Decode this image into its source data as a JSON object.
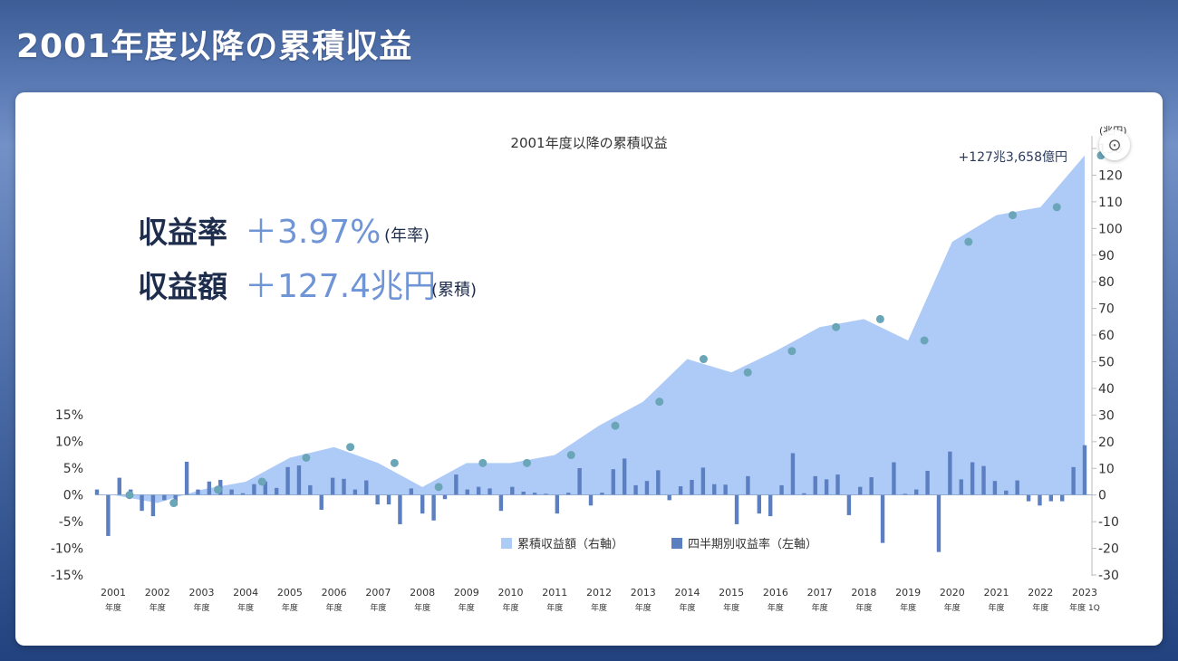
{
  "page_title": "2001年度以降の累積収益",
  "chart_data": {
    "type": "bar+area",
    "title": "2001年度以降の累積収益",
    "right_axis_unit": "(兆円)",
    "left_axis": {
      "ylim": [
        -15,
        15
      ],
      "ticks": [
        "15%",
        "10%",
        "5%",
        "0%",
        "-5%",
        "-10%",
        "-15%"
      ],
      "tick_values": [
        15,
        10,
        5,
        0,
        -5,
        -10,
        -15
      ]
    },
    "right_axis": {
      "ylim": [
        -30,
        130
      ],
      "ticks": [
        130,
        120,
        110,
        100,
        90,
        80,
        70,
        60,
        50,
        40,
        30,
        20,
        10,
        0,
        -10,
        -20,
        -30
      ]
    },
    "x_labels": [
      {
        "year": "2001",
        "sub": "年度"
      },
      {
        "year": "2002",
        "sub": "年度"
      },
      {
        "year": "2003",
        "sub": "年度"
      },
      {
        "year": "2004",
        "sub": "年度"
      },
      {
        "year": "2005",
        "sub": "年度"
      },
      {
        "year": "2006",
        "sub": "年度"
      },
      {
        "year": "2007",
        "sub": "年度"
      },
      {
        "year": "2008",
        "sub": "年度"
      },
      {
        "year": "2009",
        "sub": "年度"
      },
      {
        "year": "2010",
        "sub": "年度"
      },
      {
        "year": "2011",
        "sub": "年度"
      },
      {
        "year": "2012",
        "sub": "年度"
      },
      {
        "year": "2013",
        "sub": "年度"
      },
      {
        "year": "2014",
        "sub": "年度"
      },
      {
        "year": "2015",
        "sub": "年度"
      },
      {
        "year": "2016",
        "sub": "年度"
      },
      {
        "year": "2017",
        "sub": "年度"
      },
      {
        "year": "2018",
        "sub": "年度"
      },
      {
        "year": "2019",
        "sub": "年度"
      },
      {
        "year": "2020",
        "sub": "年度"
      },
      {
        "year": "2021",
        "sub": "年度"
      },
      {
        "year": "2022",
        "sub": "年度"
      },
      {
        "year": "2023",
        "sub": "年度 1Q"
      }
    ],
    "series": [
      {
        "name": "累積収益額（右軸）",
        "kind": "area",
        "color": "#aecbf7",
        "marker_color": "#6ba6b8",
        "values": [
          0,
          -3,
          2,
          5,
          14,
          18,
          12,
          3,
          12,
          12,
          15,
          26,
          35,
          51,
          46,
          54,
          63,
          66,
          58,
          95,
          105,
          108,
          127.4
        ]
      },
      {
        "name": "四半期別収益率（左軸）",
        "kind": "bar",
        "color": "#5b7fc0",
        "values": [
          1.0,
          -7.7,
          3.2,
          1.0,
          -3.0,
          -4.0,
          -1.0,
          -2.0,
          6.2,
          1.0,
          2.5,
          2.8,
          1.0,
          0.3,
          2.0,
          2.5,
          1.3,
          5.2,
          5.5,
          1.8,
          -2.8,
          3.2,
          3.0,
          1.0,
          2.7,
          -1.8,
          -1.8,
          -5.5,
          1.2,
          -3.5,
          -4.8,
          -0.8,
          3.8,
          1.0,
          1.5,
          1.2,
          -3.0,
          1.5,
          0.6,
          0.4,
          0.2,
          -3.5,
          0.4,
          5.0,
          -2.0,
          0.4,
          4.8,
          6.8,
          1.8,
          2.6,
          4.6,
          -1.0,
          1.6,
          2.8,
          5.1,
          2.0,
          1.9,
          -5.5,
          3.5,
          -3.5,
          -4.0,
          1.8,
          7.8,
          0.3,
          3.5,
          2.9,
          3.8,
          -3.8,
          1.5,
          3.3,
          -9.0,
          6.1,
          0.2,
          1.0,
          4.5,
          -10.7,
          8.1,
          2.9,
          6.1,
          5.4,
          2.6,
          0.8,
          2.7,
          -1.2,
          -2.0,
          -1.2,
          -1.2,
          5.2,
          9.3
        ]
      }
    ],
    "legend": {
      "placement": "bottom-center"
    },
    "annotation": "+127兆3,658億円"
  },
  "stats": {
    "rate_label": "収益率",
    "rate_value": "＋3.97%",
    "rate_suffix": "(年率)",
    "amount_label": "収益額",
    "amount_value": "＋127.4兆円",
    "amount_suffix": "(累積)"
  }
}
